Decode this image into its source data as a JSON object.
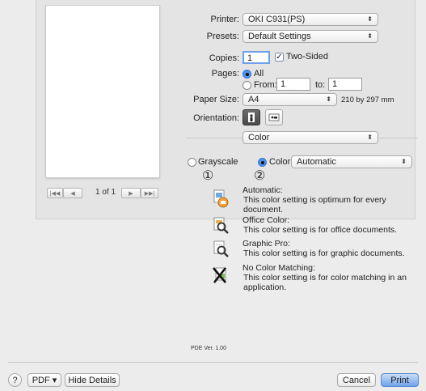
{
  "printer": {
    "label": "Printer:",
    "value": "OKI C931(PS)"
  },
  "presets": {
    "label": "Presets:",
    "value": "Default Settings"
  },
  "copies": {
    "label": "Copies:",
    "value": "1",
    "two_sided_label": "Two-Sided"
  },
  "pages": {
    "label": "Pages:",
    "all_label": "All",
    "from_label": "From:",
    "from_value": "1",
    "to_label": "to:",
    "to_value": "1"
  },
  "paper_size": {
    "label": "Paper Size:",
    "value": "A4",
    "dims": "210 by 297 mm"
  },
  "orientation": {
    "label": "Orientation:"
  },
  "section_menu": {
    "value": "Color"
  },
  "color_mode": {
    "grayscale_label": "Grayscale",
    "color_label": "Color:",
    "color_value": "Automatic"
  },
  "callouts": {
    "one": "①",
    "two": "②"
  },
  "preview": {
    "page_indicator": "1 of 1"
  },
  "descriptions": [
    {
      "title": "Automatic:",
      "text": "This color setting is optimum for every document."
    },
    {
      "title": "Office Color:",
      "text": "This color setting is for office documents."
    },
    {
      "title": "Graphic Pro:",
      "text": "This color setting is for graphic documents."
    },
    {
      "title": "No Color Matching:",
      "text": "This color setting is for color matching in an application."
    }
  ],
  "pde_version": "PDE Ver.  1.00",
  "bottom": {
    "help": "?",
    "pdf_label": "PDF ▾",
    "hide_details": "Hide Details",
    "cancel": "Cancel",
    "print": "Print"
  },
  "colors": {
    "accent": "#4f8fe8",
    "print_button": "#6ea3e9"
  }
}
